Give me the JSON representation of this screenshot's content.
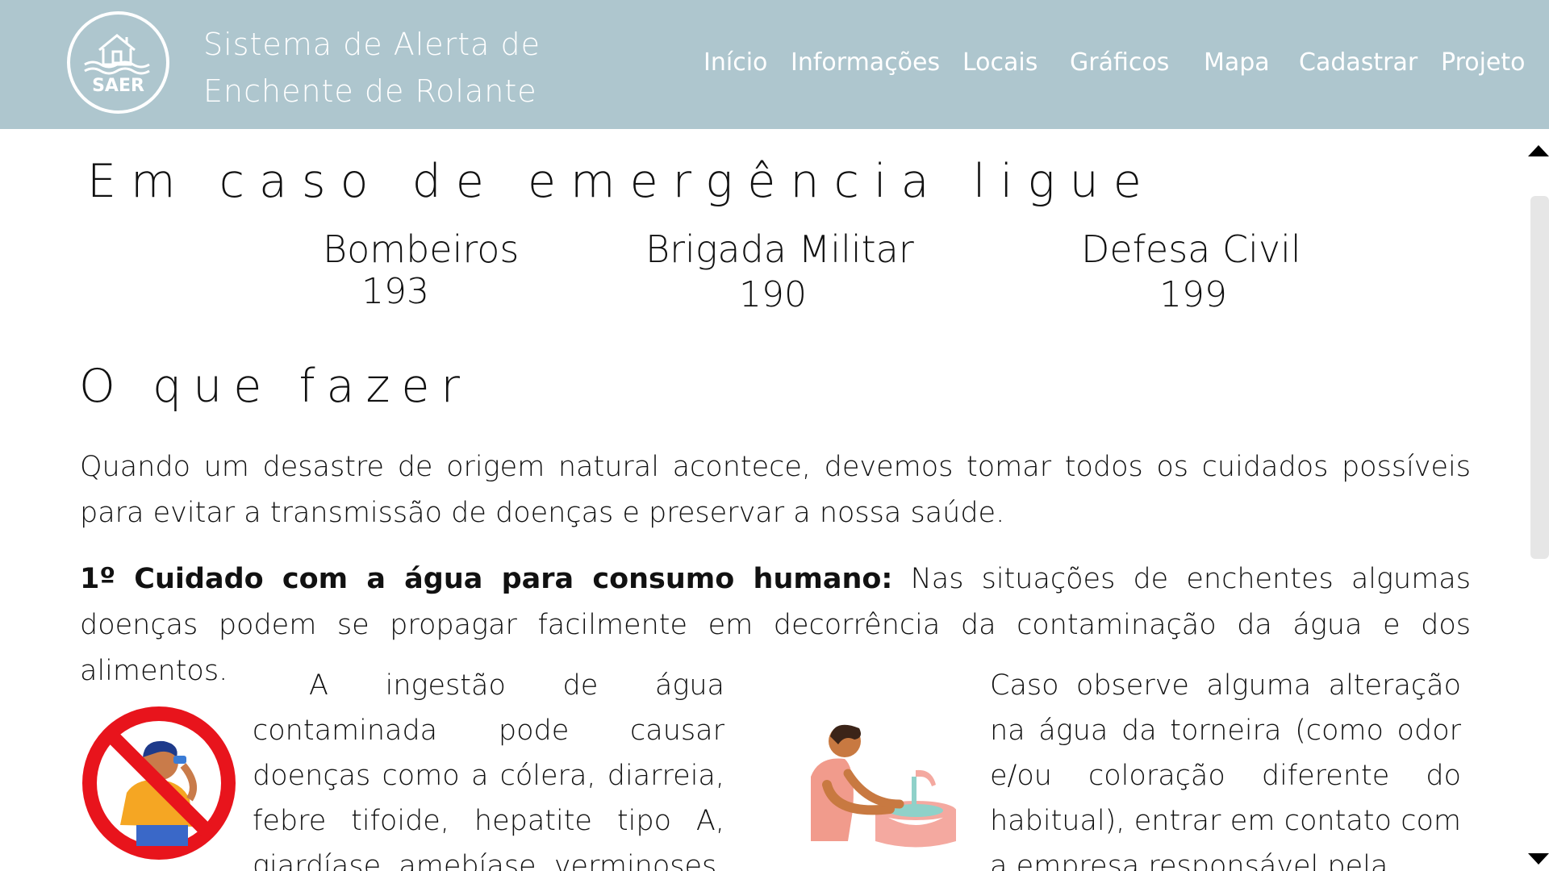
{
  "header": {
    "logo_text": "SAER",
    "title_line1": "Sistema de Alerta de",
    "title_line2": "Enchente de Rolante",
    "nav": [
      "Início",
      "Informações",
      "Locais",
      "Gráficos",
      "Mapa",
      "Cadastrar",
      "Projeto"
    ]
  },
  "emergency": {
    "heading": "Em caso de emergência ligue",
    "contacts": [
      {
        "name": "Bombeiros",
        "number": "193"
      },
      {
        "name": "Brigada Militar",
        "number": "190"
      },
      {
        "name": "Defesa Civil",
        "number": "199"
      }
    ]
  },
  "what_to_do": {
    "heading": "O que fazer",
    "intro": "Quando um desastre de origem natural acontece, devemos tomar todos os cuidados possíveis para evitar a transmissão de doenças e preservar a nossa saúde.",
    "care1_title": "1º Cuidado com a água para consumo humano:",
    "care1_text": " Nas situações de enchentes algumas doenças podem se propagar facilmente em decorrência da contaminação da água e dos alimentos.",
    "left_text": "A ingestão de água contaminada pode causar doenças como a cólera, diarreia, febre tifoide, hepatite tipo A, giardíase, amebíase, verminoses",
    "right_text": "Caso observe alguma alteração na água da torneira (como odor e/ou coloração diferente do habitual), entrar em contato com a empresa responsável pela"
  },
  "icons": {
    "no_drink": "no-drinking-water-icon",
    "washing": "washing-hands-icon"
  },
  "colors": {
    "header_bg": "#aec6ce",
    "prohibition_red": "#e8141c"
  }
}
